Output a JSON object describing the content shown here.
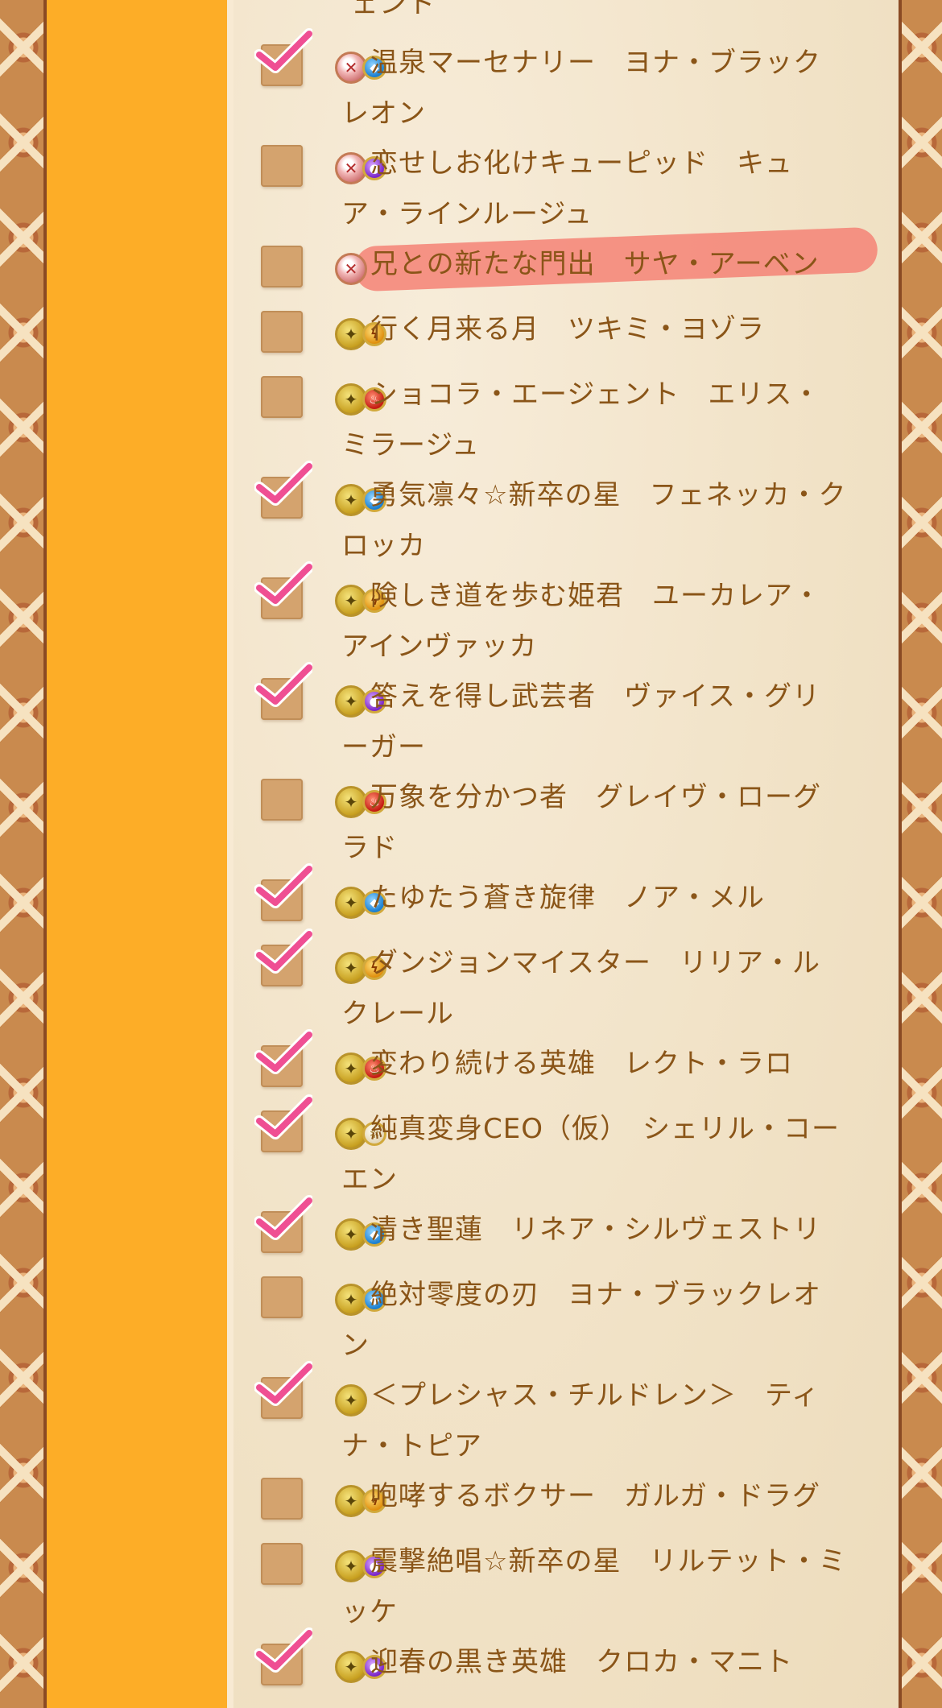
{
  "top_fragment": "ェント",
  "items": [
    {
      "checked": true,
      "rarity_icon": "rarity-pink-icon",
      "attr_icon": "water-attr-icon",
      "line1": "温泉マーセナリー　ヨナ・ブラック",
      "line2": "レオン"
    },
    {
      "checked": false,
      "rarity_icon": "rarity-pink-icon",
      "attr_icon": "dark-attr-icon",
      "line1": "恋せしお化けキューピッド　キュ",
      "line2": "ア・ラインルージュ"
    },
    {
      "checked": false,
      "rarity_icon": "rarity-pink-icon",
      "attr_icon": "",
      "line1": "兄との新たな門出　サヤ・アーベン",
      "line2": ""
    },
    {
      "checked": false,
      "rarity_icon": "rarity-gold-icon",
      "attr_icon": "thunder-attr-icon",
      "line1": "行く月来る月　ツキミ・ヨゾラ",
      "line2": ""
    },
    {
      "checked": false,
      "rarity_icon": "rarity-gold-icon",
      "attr_icon": "fire-attr-icon",
      "line1": "ショコラ・エージェント　エリス・",
      "line2": "ミラージュ"
    },
    {
      "checked": true,
      "rarity_icon": "rarity-gold-icon",
      "attr_icon": "water-attr-icon",
      "line1": "勇気凛々☆新卒の星　フェネッカ・ク",
      "line2": "ロッカ"
    },
    {
      "checked": true,
      "rarity_icon": "rarity-gold-icon",
      "attr_icon": "thunder-attr-icon",
      "line1": "険しき道を歩む姫君　ユーカレア・",
      "line2": "アインヴァッカ"
    },
    {
      "checked": true,
      "rarity_icon": "rarity-gold-icon",
      "attr_icon": "dark-attr-icon",
      "line1": "答えを得し武芸者　ヴァイス・グリ",
      "line2": "ーガー"
    },
    {
      "checked": false,
      "rarity_icon": "rarity-gold-icon",
      "attr_icon": "fire-attr-icon",
      "line1": "万象を分かつ者　グレイヴ・ローグ",
      "line2": "ラド"
    },
    {
      "checked": true,
      "rarity_icon": "rarity-gold-icon",
      "attr_icon": "water-attr-icon",
      "line1": "たゆたう蒼き旋律　ノア・メル",
      "line2": ""
    },
    {
      "checked": true,
      "rarity_icon": "rarity-gold-icon",
      "attr_icon": "thunder-attr-icon",
      "line1": "ダンジョンマイスター　リリア・ル",
      "line2": "クレール"
    },
    {
      "checked": true,
      "rarity_icon": "rarity-gold-icon",
      "attr_icon": "fire-attr-icon",
      "line1": "変わり続ける英雄　レクト・ラロ",
      "line2": ""
    },
    {
      "checked": true,
      "rarity_icon": "rarity-gold-icon",
      "attr_icon": "light-attr-icon",
      "line1": "純真変身CEO（仮）　シェリル・コー",
      "line2": "エン"
    },
    {
      "checked": true,
      "rarity_icon": "rarity-gold-icon",
      "attr_icon": "water-attr-icon",
      "line1": "清き聖蓮　リネア・シルヴェストリ",
      "line2": ""
    },
    {
      "checked": false,
      "rarity_icon": "rarity-gold-icon",
      "attr_icon": "water-attr-icon",
      "line1": "絶対零度の刃　ヨナ・ブラックレオ",
      "line2": "ン"
    },
    {
      "checked": true,
      "rarity_icon": "rarity-gold-icon",
      "attr_icon": "",
      "line1": "＜プレシャス・チルドレン＞　ティ",
      "line2": "ナ・トピア"
    },
    {
      "checked": false,
      "rarity_icon": "rarity-gold-icon",
      "attr_icon": "thunder-attr-icon",
      "line1": "咆哮するボクサー　ガルガ・ドラグ",
      "line2": ""
    },
    {
      "checked": false,
      "rarity_icon": "rarity-gold-icon",
      "attr_icon": "dark-attr-icon",
      "line1": "震撃絶唱☆新卒の星　リルテット・ミ",
      "line2": "ッケ"
    },
    {
      "checked": true,
      "rarity_icon": "rarity-gold-icon",
      "attr_icon": "dark-attr-icon",
      "line1": "迎春の黒き英雄　クロカ・マニト",
      "line2": ""
    }
  ]
}
